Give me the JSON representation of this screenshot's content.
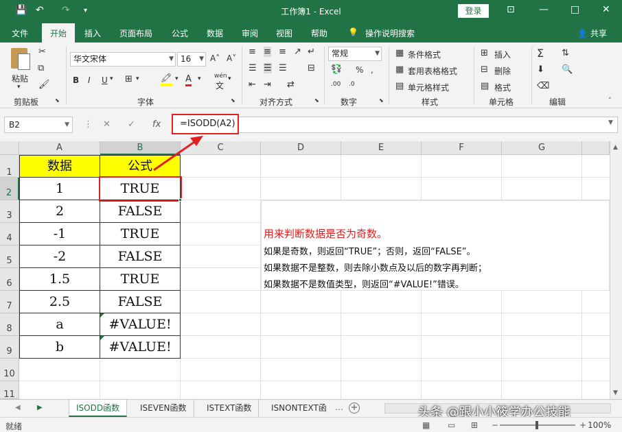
{
  "window": {
    "title": "工作簿1  -  Excel",
    "login_label": "登录",
    "minimize": "—",
    "restore": "□",
    "close": "✕",
    "ribbon_display": "⊡"
  },
  "quick_access": {
    "save": "💾",
    "undo": "↶",
    "redo": "↷",
    "customize": "▾"
  },
  "tabs": [
    "文件",
    "开始",
    "插入",
    "页面布局",
    "公式",
    "数据",
    "审阅",
    "视图",
    "帮助"
  ],
  "active_tab": "开始",
  "tell_me": "操作说明搜索",
  "share": "共享",
  "ribbon": {
    "groups": [
      "剪贴板",
      "字体",
      "对齐方式",
      "数字",
      "样式",
      "单元格",
      "编辑"
    ],
    "paste": "粘贴",
    "font_name": "华文宋体",
    "font_size": "16",
    "bold": "B",
    "italic": "I",
    "underline": "U",
    "number_format": "常规",
    "percent": "%",
    "comma": ",",
    "conditional_format": "条件格式",
    "table_format": "套用表格格式",
    "cell_styles": "单元格样式",
    "insert": "插入",
    "delete": "删除",
    "format": "格式",
    "wen": "wén"
  },
  "formula_bar": {
    "name_box": "B2",
    "formula": "=ISODD(A2)",
    "fx": "fx",
    "cancel": "✕",
    "enter": "✓"
  },
  "columns": [
    "A",
    "B",
    "C",
    "D",
    "E",
    "F",
    "G"
  ],
  "rows": [
    "1",
    "2",
    "3",
    "4",
    "5",
    "6",
    "7",
    "8",
    "9",
    "10",
    "11"
  ],
  "table": {
    "header": [
      "数据",
      "公式"
    ],
    "rows": [
      [
        "1",
        "TRUE"
      ],
      [
        "2",
        "FALSE"
      ],
      [
        "-1",
        "TRUE"
      ],
      [
        "-2",
        "FALSE"
      ],
      [
        "1.5",
        "TRUE"
      ],
      [
        "2.5",
        "FALSE"
      ],
      [
        "a",
        "#VALUE!"
      ],
      [
        "b",
        "#VALUE!"
      ]
    ]
  },
  "note": {
    "title": "用来判断数据是否为奇数。",
    "lines": [
      "如果是奇数，则返回“TRUE”；否则，返回“FALSE”。",
      "如果数据不是整数，则去除小数点及以后的数字再判断；",
      "如果数据不是数值类型，则返回“#VALUE!”错误。"
    ]
  },
  "sheets": [
    "ISODD函数",
    "ISEVEN函数",
    "ISTEXT函数",
    "ISNONTEXT函"
  ],
  "active_sheet": "ISODD函数",
  "watermark": "头条 @跟小小筱学办公技能",
  "status": {
    "ready": "就绪",
    "zoom": "100%",
    "minus": "−",
    "plus": "+"
  },
  "colors": {
    "excel_green": "#217346",
    "header_yellow": "#ffff00",
    "highlight_red": "#e02020"
  }
}
